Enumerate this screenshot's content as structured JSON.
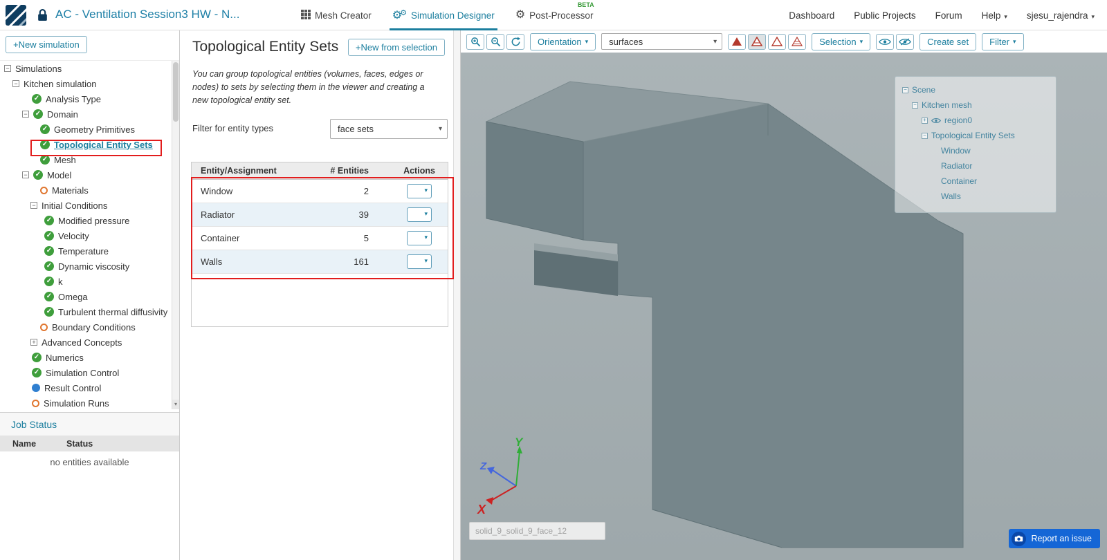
{
  "colors": {
    "accent": "#1b7e9e",
    "highlight": "#e21d1d",
    "status_ok": "#3f9e3c",
    "status_warn": "#e0762f",
    "status_info": "#2f7fd0",
    "viewport_bg": "#a5afb2",
    "model_gray": "#76868b"
  },
  "header": {
    "project_title": "AC - Ventilation Session3 HW - N...",
    "nav_mesh_creator": "Mesh Creator",
    "nav_simulation_designer": "Simulation Designer",
    "nav_post_processor": "Post-Processor",
    "beta": "BETA",
    "link_dashboard": "Dashboard",
    "link_public_projects": "Public Projects",
    "link_forum": "Forum",
    "link_help": "Help",
    "user": "sjesu_rajendra"
  },
  "sidebar": {
    "new_simulation": "+New simulation",
    "tree": [
      {
        "label": "Simulations",
        "icon": "collapse"
      },
      {
        "label": "Kitchen simulation",
        "icon": "collapse"
      },
      {
        "label": "Analysis Type",
        "icon": "check"
      },
      {
        "label": "Domain",
        "icon": "collapse-check"
      },
      {
        "label": "Geometry Primitives",
        "icon": "check"
      },
      {
        "label": "Topological Entity Sets",
        "icon": "check",
        "selected": true
      },
      {
        "label": "Mesh",
        "icon": "check"
      },
      {
        "label": "Model",
        "icon": "collapse-check"
      },
      {
        "label": "Materials",
        "icon": "warning"
      },
      {
        "label": "Initial Conditions",
        "icon": "collapse"
      },
      {
        "label": "Modified pressure",
        "icon": "check"
      },
      {
        "label": "Velocity",
        "icon": "check"
      },
      {
        "label": "Temperature",
        "icon": "check"
      },
      {
        "label": "Dynamic viscosity",
        "icon": "check"
      },
      {
        "label": "k",
        "icon": "check"
      },
      {
        "label": "Omega",
        "icon": "check"
      },
      {
        "label": "Turbulent thermal diffusivity",
        "icon": "check"
      },
      {
        "label": "Boundary Conditions",
        "icon": "warning"
      },
      {
        "label": "Advanced Concepts",
        "icon": "expand"
      },
      {
        "label": "Numerics",
        "icon": "check"
      },
      {
        "label": "Simulation Control",
        "icon": "check"
      },
      {
        "label": "Result Control",
        "icon": "info"
      },
      {
        "label": "Simulation Runs",
        "icon": "warning"
      }
    ],
    "job_status": {
      "title": "Job Status",
      "col_name": "Name",
      "col_status": "Status",
      "empty": "no entities available"
    }
  },
  "panel": {
    "title": "Topological Entity Sets",
    "new_from_selection": "+New from selection",
    "description": "You can group topological entities (volumes, faces, edges or nodes) to sets by selecting them in the viewer and creating a new topological entity set.",
    "filter_label": "Filter for entity types",
    "filter_value": "face sets",
    "table": {
      "col_entity": "Entity/Assignment",
      "col_count": "# Entities",
      "col_actions": "Actions",
      "rows": [
        {
          "name": "Window",
          "count": "2"
        },
        {
          "name": "Radiator",
          "count": "39"
        },
        {
          "name": "Container",
          "count": "5"
        },
        {
          "name": "Walls",
          "count": "161"
        }
      ]
    }
  },
  "viewer": {
    "toolbar": {
      "orientation": "Orientation",
      "mode": "surfaces",
      "selection": "Selection",
      "create_set": "Create set",
      "filter": "Filter"
    },
    "scene_tree": {
      "scene": "Scene",
      "mesh": "Kitchen mesh",
      "region": "region0",
      "sets": "Topological Entity Sets",
      "items": [
        "Window",
        "Radiator",
        "Container",
        "Walls"
      ]
    },
    "axes": {
      "x": "X",
      "y": "Y",
      "z": "Z"
    },
    "selection_value": "solid_9_solid_9_face_12",
    "report_issue": "Report an issue"
  }
}
